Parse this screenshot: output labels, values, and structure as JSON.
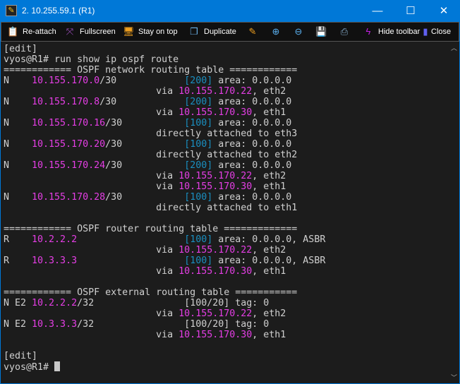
{
  "window": {
    "title": "2. 10.255.59.1 (R1)",
    "minimize": "—",
    "maximize": "☐",
    "close": "✕"
  },
  "toolbar": {
    "reattach": "Re-attach",
    "fullscreen": "Fullscreen",
    "stay_on_top": "Stay on top",
    "duplicate": "Duplicate",
    "hide_toolbar": "Hide toolbar",
    "close": "Close"
  },
  "colors": {
    "accent": "#0078d7",
    "ip": "#e53ee5",
    "metric": "#1a8fc0",
    "text": "#d0d0d0",
    "background": "#1c1c1c"
  },
  "terminal": {
    "lines": [
      [
        [
          "[edit]",
          "w"
        ]
      ],
      [
        [
          "vyos@R1# run show ip ospf route",
          "w"
        ]
      ],
      [
        [
          "============ OSPF network routing table ============",
          "w"
        ]
      ],
      [
        [
          "N    ",
          "w"
        ],
        [
          "10.155.170.0",
          "m"
        ],
        [
          "/30            ",
          "w"
        ],
        [
          "[200]",
          "b"
        ],
        [
          " area: 0.0.0.0",
          "w"
        ]
      ],
      [
        [
          "                           via ",
          "w"
        ],
        [
          "10.155.170.22",
          "m"
        ],
        [
          ", eth2",
          "w"
        ]
      ],
      [
        [
          "N    ",
          "w"
        ],
        [
          "10.155.170.8",
          "m"
        ],
        [
          "/30            ",
          "w"
        ],
        [
          "[200]",
          "b"
        ],
        [
          " area: 0.0.0.0",
          "w"
        ]
      ],
      [
        [
          "                           via ",
          "w"
        ],
        [
          "10.155.170.30",
          "m"
        ],
        [
          ", eth1",
          "w"
        ]
      ],
      [
        [
          "N    ",
          "w"
        ],
        [
          "10.155.170.16",
          "m"
        ],
        [
          "/30           ",
          "w"
        ],
        [
          "[100]",
          "b"
        ],
        [
          " area: 0.0.0.0",
          "w"
        ]
      ],
      [
        [
          "                           directly attached to eth3",
          "w"
        ]
      ],
      [
        [
          "N    ",
          "w"
        ],
        [
          "10.155.170.20",
          "m"
        ],
        [
          "/30           ",
          "w"
        ],
        [
          "[100]",
          "b"
        ],
        [
          " area: 0.0.0.0",
          "w"
        ]
      ],
      [
        [
          "                           directly attached to eth2",
          "w"
        ]
      ],
      [
        [
          "N    ",
          "w"
        ],
        [
          "10.155.170.24",
          "m"
        ],
        [
          "/30           ",
          "w"
        ],
        [
          "[200]",
          "b"
        ],
        [
          " area: 0.0.0.0",
          "w"
        ]
      ],
      [
        [
          "                           via ",
          "w"
        ],
        [
          "10.155.170.22",
          "m"
        ],
        [
          ", eth2",
          "w"
        ]
      ],
      [
        [
          "                           via ",
          "w"
        ],
        [
          "10.155.170.30",
          "m"
        ],
        [
          ", eth1",
          "w"
        ]
      ],
      [
        [
          "N    ",
          "w"
        ],
        [
          "10.155.170.28",
          "m"
        ],
        [
          "/30           ",
          "w"
        ],
        [
          "[100]",
          "b"
        ],
        [
          " area: 0.0.0.0",
          "w"
        ]
      ],
      [
        [
          "                           directly attached to eth1",
          "w"
        ]
      ],
      [],
      [
        [
          "============ OSPF router routing table =============",
          "w"
        ]
      ],
      [
        [
          "R    ",
          "w"
        ],
        [
          "10.2.2.2",
          "m"
        ],
        [
          "                   ",
          "w"
        ],
        [
          "[100]",
          "b"
        ],
        [
          " area: 0.0.0.0, ASBR",
          "w"
        ]
      ],
      [
        [
          "                           via ",
          "w"
        ],
        [
          "10.155.170.22",
          "m"
        ],
        [
          ", eth2",
          "w"
        ]
      ],
      [
        [
          "R    ",
          "w"
        ],
        [
          "10.3.3.3",
          "m"
        ],
        [
          "                   ",
          "w"
        ],
        [
          "[100]",
          "b"
        ],
        [
          " area: 0.0.0.0, ASBR",
          "w"
        ]
      ],
      [
        [
          "                           via ",
          "w"
        ],
        [
          "10.155.170.30",
          "m"
        ],
        [
          ", eth1",
          "w"
        ]
      ],
      [],
      [
        [
          "============ OSPF external routing table ===========",
          "w"
        ]
      ],
      [
        [
          "N E2 ",
          "w"
        ],
        [
          "10.2.2.2",
          "m"
        ],
        [
          "/32                ",
          "w"
        ],
        [
          "[100/20] tag: 0",
          "w"
        ]
      ],
      [
        [
          "                           via ",
          "w"
        ],
        [
          "10.155.170.22",
          "m"
        ],
        [
          ", eth2",
          "w"
        ]
      ],
      [
        [
          "N E2 ",
          "w"
        ],
        [
          "10.3.3.3",
          "m"
        ],
        [
          "/32                ",
          "w"
        ],
        [
          "[100/20] tag: 0",
          "w"
        ]
      ],
      [
        [
          "                           via ",
          "w"
        ],
        [
          "10.155.170.30",
          "m"
        ],
        [
          ", eth1",
          "w"
        ]
      ],
      [],
      [
        [
          "[edit]",
          "w"
        ]
      ],
      [
        [
          "vyos@R1# ",
          "w"
        ]
      ]
    ]
  }
}
